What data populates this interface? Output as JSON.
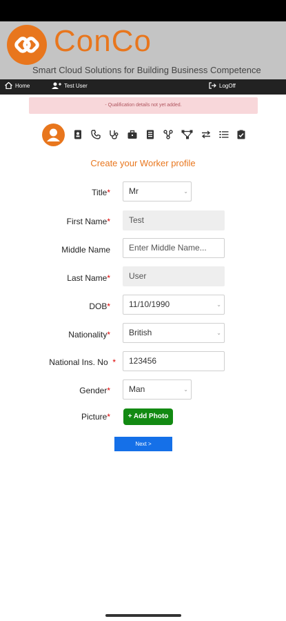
{
  "brand": {
    "name": "ConCo",
    "tagline": "Smart Cloud Solutions for Building Business Competence",
    "accent": "#e8761d"
  },
  "nav": {
    "home": "Home",
    "user": "Test User",
    "logoff": "LogOff"
  },
  "alert": "- Qualification details not yet added.",
  "stepper": {
    "icons": [
      "person-icon",
      "contact-card-icon",
      "phone-icon",
      "stethoscope-icon",
      "briefcase-icon",
      "document-icon",
      "network-icon",
      "share-icon",
      "exchange-icon",
      "list-icon",
      "checklist-icon"
    ]
  },
  "form": {
    "title": "Create your Worker profile",
    "fields": {
      "title": {
        "label": "Title",
        "value": "Mr"
      },
      "first_name": {
        "label": "First Name",
        "value": "Test"
      },
      "middle_name": {
        "label": "Middle Name",
        "placeholder": "Enter Middle Name..."
      },
      "last_name": {
        "label": "Last Name",
        "value": "User"
      },
      "dob": {
        "label": "DOB",
        "value": "11/10/1990"
      },
      "nationality": {
        "label": "Nationality",
        "value": "British"
      },
      "national_ins": {
        "label": "National Ins. No",
        "value": "123456"
      },
      "gender": {
        "label": "Gender",
        "value": "Man"
      },
      "picture": {
        "label": "Picture"
      }
    },
    "required_mark": "*",
    "add_photo": "+ Add Photo",
    "next": "Next >"
  }
}
